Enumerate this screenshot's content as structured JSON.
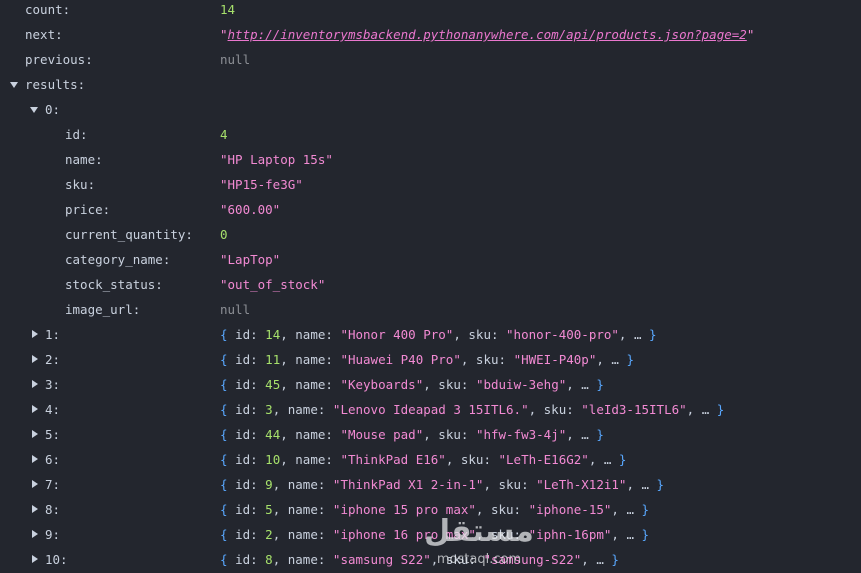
{
  "root": {
    "count": {
      "key": "count:",
      "value": "14"
    },
    "next": {
      "key": "next:",
      "value": "\"http://inventorymsbackend.pythonanywhere.com/api/products.json?page=2\""
    },
    "previous": {
      "key": "previous:",
      "value": "null"
    },
    "results": {
      "key": "results:"
    }
  },
  "item0": {
    "key": "0:",
    "fields": [
      {
        "key": "id:",
        "value": "4"
      },
      {
        "key": "name:",
        "value": "\"HP Laptop 15s\""
      },
      {
        "key": "sku:",
        "value": "\"HP15-fe3G\""
      },
      {
        "key": "price:",
        "value": "\"600.00\""
      },
      {
        "key": "current_quantity:",
        "value": "0"
      },
      {
        "key": "category_name:",
        "value": "\"LapTop\""
      },
      {
        "key": "stock_status:",
        "value": "\"out_of_stock\""
      },
      {
        "key": "image_url:",
        "value": "null"
      }
    ]
  },
  "collapsed": [
    {
      "key": "1:",
      "id": "14",
      "name": "\"Honor 400 Pro\"",
      "sku": "\"honor-400-pro\""
    },
    {
      "key": "2:",
      "id": "11",
      "name": "\"Huawei P40 Pro\"",
      "sku": "\"HWEI-P40p\""
    },
    {
      "key": "3:",
      "id": "45",
      "name": "\"Keyboards\"",
      "sku": "\"bduiw-3ehg\""
    },
    {
      "key": "4:",
      "id": "3",
      "name": "\"Lenovo Ideapad 3 15ITL6.\"",
      "sku": "\"leId3-15ITL6\""
    },
    {
      "key": "5:",
      "id": "44",
      "name": "\"Mouse pad\"",
      "sku": "\"hfw-fw3-4j\""
    },
    {
      "key": "6:",
      "id": "10",
      "name": "\"ThinkPad E16\"",
      "sku": "\"LeTh-E16G2\""
    },
    {
      "key": "7:",
      "id": "9",
      "name": "\"ThinkPad X1 2-in-1\"",
      "sku": "\"LeTh-X12i1\""
    },
    {
      "key": "8:",
      "id": "5",
      "name": "\"iphone 15 pro max\"",
      "sku": "\"iphone-15\""
    },
    {
      "key": "9:",
      "id": "2",
      "name": "\"iphone 16 pro max\"",
      "sku": "\"iphn-16pm\""
    },
    {
      "key": "10:",
      "id": "8",
      "name": "\"samsung S22\"",
      "sku": "\"samsung-S22\""
    }
  ],
  "labels": {
    "id": "id",
    "name": "name",
    "sku": "sku",
    "colon": ":",
    "comma": ",",
    "open": "{",
    "close": "}",
    "ellipsis": "…"
  },
  "watermark": {
    "arabic": "مستقل",
    "domain": "mostaql.com"
  },
  "colors": {
    "background": "#23262e",
    "key": "#c9d1de",
    "number": "#a6e06b",
    "string": "#f28ad3",
    "null": "#8c8f95",
    "brace": "#59a8ff"
  }
}
